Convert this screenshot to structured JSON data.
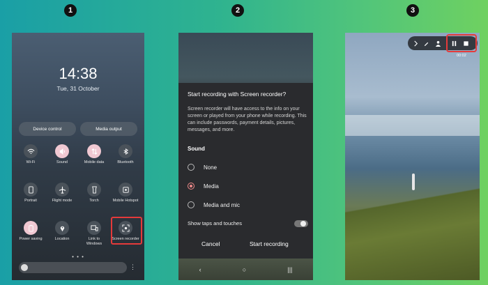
{
  "steps": [
    "1",
    "2",
    "3"
  ],
  "panel1": {
    "clock": "14:38",
    "date": "Tue, 31 October",
    "buttons": [
      "Device control",
      "Media output"
    ],
    "tiles": [
      {
        "label": "Wi-Fi",
        "icon": "wifi-icon",
        "active": false
      },
      {
        "label": "Sound",
        "icon": "speaker-icon",
        "active": true
      },
      {
        "label": "Mobile data",
        "icon": "mobile-data-icon",
        "active": true
      },
      {
        "label": "Bluetooth",
        "icon": "bluetooth-icon",
        "active": false
      },
      {
        "label": "Portrait",
        "icon": "portrait-lock-icon",
        "active": false
      },
      {
        "label": "Flight mode",
        "icon": "airplane-icon",
        "active": false
      },
      {
        "label": "Torch",
        "icon": "torch-icon",
        "active": false
      },
      {
        "label": "Mobile Hotspot",
        "icon": "hotspot-icon",
        "active": false
      },
      {
        "label": "Power saving",
        "icon": "battery-icon",
        "active": true
      },
      {
        "label": "Location",
        "icon": "location-icon",
        "active": false
      },
      {
        "label": "Link to Windows",
        "icon": "link-windows-icon",
        "active": false
      },
      {
        "label": "Screen recorder",
        "icon": "screen-recorder-icon",
        "active": false
      }
    ],
    "page_dots": "• • •",
    "more": "⋮"
  },
  "panel2": {
    "title": "Start recording with Screen recorder?",
    "description": "Screen recorder will have access to the info on your screen or played from your phone while recording. This can include passwords, payment details, pictures, messages, and more.",
    "sound_label": "Sound",
    "options": [
      {
        "label": "None",
        "selected": false
      },
      {
        "label": "Media",
        "selected": true
      },
      {
        "label": "Media and mic",
        "selected": false
      }
    ],
    "show_taps_label": "Show taps and touches",
    "show_taps_on": false,
    "cancel_label": "Cancel",
    "start_label": "Start recording",
    "nav": {
      "back": "‹",
      "home": "○",
      "recents": "|||"
    }
  },
  "panel3": {
    "timer": "00:02"
  },
  "colors": {
    "highlight": "#e53a3a",
    "active_tile": "#f0c8d2",
    "radio_selected": "#f08a8a"
  }
}
